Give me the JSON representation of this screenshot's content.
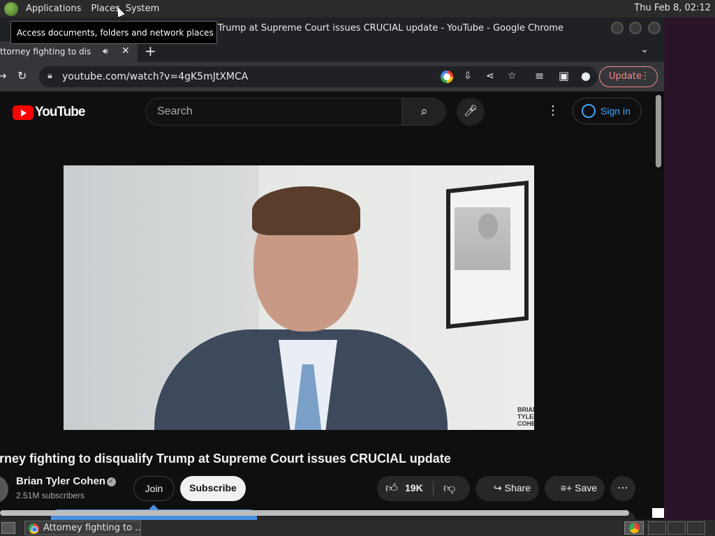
{
  "desktop": {
    "menus": [
      "Applications",
      "Places",
      "System"
    ],
    "clock": "Thu Feb  8, 02:12",
    "tooltip": "Access documents, folders and network places"
  },
  "browser": {
    "window_title": "Trump at Supreme Court issues CRUCIAL update - YouTube - Google Chrome",
    "tab_title": "ttorney fighting to disqu",
    "new_tab": "+",
    "url": "youtube.com/watch?v=4gK5mJtXMCA",
    "update_label": "Update"
  },
  "youtube": {
    "logo_text": "YouTube",
    "search_placeholder": "Search",
    "signin_label": "Sign in",
    "video_title": "orney fighting to disqualify Trump at Supreme Court issues CRUCIAL update",
    "watermark": "BRIAN\nTYLER\nCOHEN",
    "channel_name": "Brian Tyler Cohen",
    "subscribers": "2.51M subscribers",
    "join_label": "Join",
    "subscribe_label": "Subscribe",
    "like_count": "19K",
    "share_label": "Share",
    "save_label": "Save"
  },
  "taskbar": {
    "task_label": "Attorney fighting to ..."
  }
}
